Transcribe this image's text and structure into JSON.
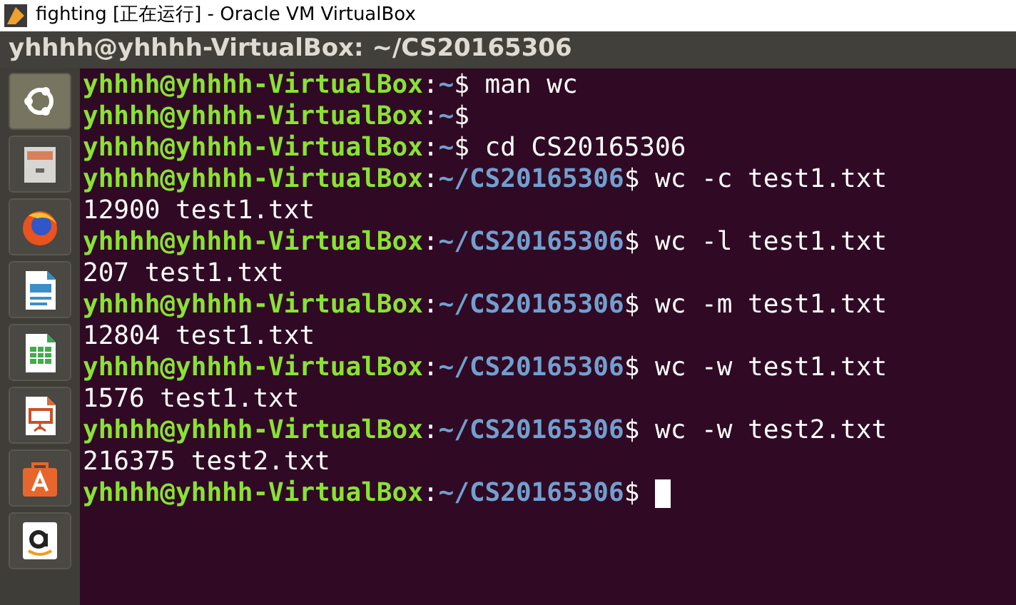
{
  "window": {
    "title": "fighting [正在运行] - Oracle VM VirtualBox"
  },
  "terminal": {
    "title": "yhhhh@yhhhh-VirtualBox: ~/CS20165306",
    "lines": [
      {
        "kind": "prompt",
        "user": "yhhhh@yhhhh-VirtualBox",
        "sep": ":",
        "path": "~",
        "sigil": "$",
        "command": "man wc"
      },
      {
        "kind": "prompt",
        "user": "yhhhh@yhhhh-VirtualBox",
        "sep": ":",
        "path": "~",
        "sigil": "$"
      },
      {
        "kind": "prompt",
        "user": "yhhhh@yhhhh-VirtualBox",
        "sep": ":",
        "path": "~",
        "sigil": "$",
        "command": "cd CS20165306"
      },
      {
        "kind": "prompt",
        "user": "yhhhh@yhhhh-VirtualBox",
        "sep": ":",
        "path": "~/CS20165306",
        "sigil": "$",
        "command": "wc -c test1.txt"
      },
      {
        "kind": "output",
        "text": "12900 test1.txt"
      },
      {
        "kind": "prompt",
        "user": "yhhhh@yhhhh-VirtualBox",
        "sep": ":",
        "path": "~/CS20165306",
        "sigil": "$",
        "command": "wc -l test1.txt"
      },
      {
        "kind": "output",
        "text": "207 test1.txt"
      },
      {
        "kind": "prompt",
        "user": "yhhhh@yhhhh-VirtualBox",
        "sep": ":",
        "path": "~/CS20165306",
        "sigil": "$",
        "command": "wc -m test1.txt"
      },
      {
        "kind": "output",
        "text": "12804 test1.txt"
      },
      {
        "kind": "prompt",
        "user": "yhhhh@yhhhh-VirtualBox",
        "sep": ":",
        "path": "~/CS20165306",
        "sigil": "$",
        "command": "wc -w test1.txt"
      },
      {
        "kind": "output",
        "text": "1576 test1.txt"
      },
      {
        "kind": "prompt",
        "user": "yhhhh@yhhhh-VirtualBox",
        "sep": ":",
        "path": "~/CS20165306",
        "sigil": "$",
        "command": "wc -w test2.txt"
      },
      {
        "kind": "output",
        "text": "216375 test2.txt"
      },
      {
        "kind": "prompt",
        "user": "yhhhh@yhhhh-VirtualBox",
        "sep": ":",
        "path": "~/CS20165306",
        "sigil": "$",
        "cursor": true
      }
    ]
  }
}
